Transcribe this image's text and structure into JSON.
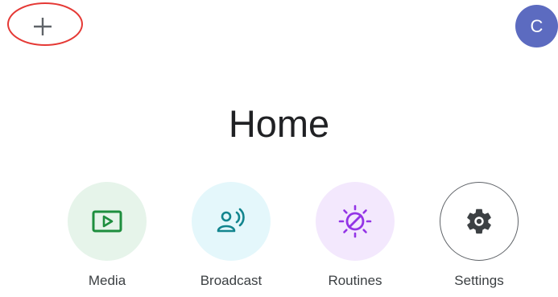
{
  "header": {
    "add_icon": "plus-icon",
    "avatar_initial": "C",
    "avatar_color": "#5c6bc0",
    "highlight_color": "#e53935"
  },
  "page": {
    "title": "Home"
  },
  "actions": [
    {
      "label": "Media",
      "icon": "play-video-icon",
      "bg": "#e6f4ea",
      "fg": "#1e8e3e"
    },
    {
      "label": "Broadcast",
      "icon": "broadcast-icon",
      "bg": "#e4f7fb",
      "fg": "#12858e"
    },
    {
      "label": "Routines",
      "icon": "routines-icon",
      "bg": "#f3e8fd",
      "fg": "#9334e6"
    },
    {
      "label": "Settings",
      "icon": "gear-icon",
      "bg": "#ffffff",
      "fg": "#3c4043"
    }
  ]
}
